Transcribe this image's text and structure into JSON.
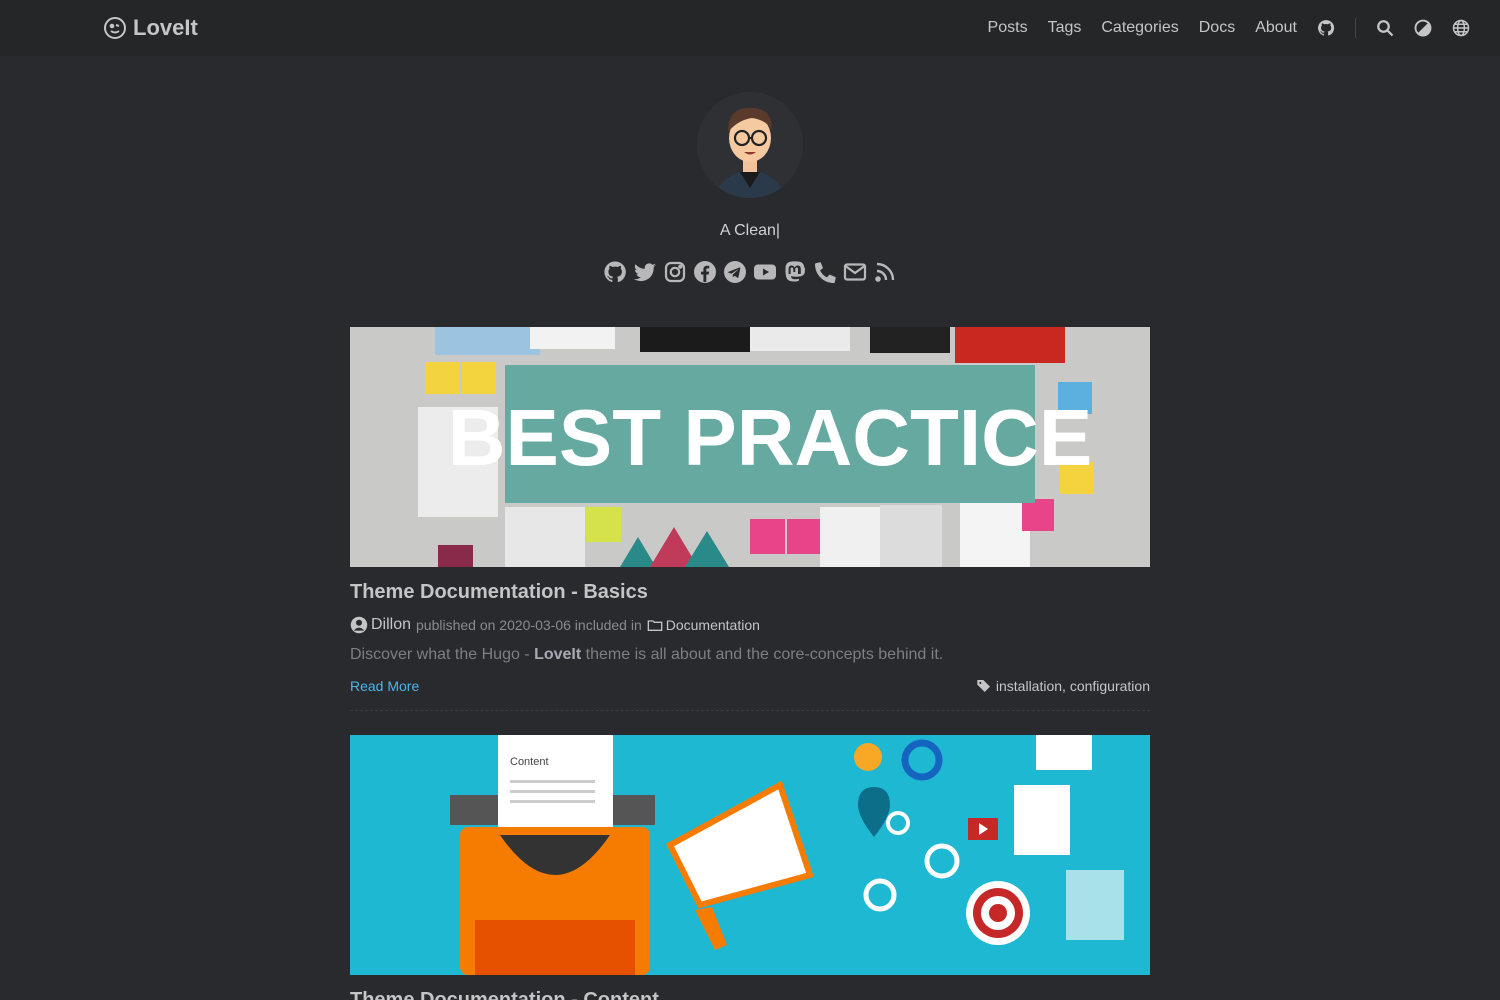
{
  "header": {
    "logo_text": "LoveIt",
    "nav": [
      "Posts",
      "Tags",
      "Categories",
      "Docs",
      "About"
    ],
    "icons": [
      "github-icon",
      "search-icon",
      "theme-switch-icon",
      "language-icon"
    ]
  },
  "profile": {
    "subtitle": "A Clean|",
    "social_icons": [
      "github-icon",
      "twitter-icon",
      "instagram-icon",
      "facebook-icon",
      "telegram-icon",
      "youtube-icon",
      "mastodon-icon",
      "phone-icon",
      "email-icon",
      "rss-icon"
    ]
  },
  "posts": [
    {
      "image_text": "BEST PRACTICE",
      "title": "Theme Documentation - Basics",
      "author": "Dillon",
      "published": "published on 2020-03-06 included in",
      "category": "Documentation",
      "summary_before": "Discover what the Hugo - ",
      "summary_bold": "LoveIt",
      "summary_after": " theme is all about and the core-concepts behind it.",
      "read_more": "Read More",
      "tags": "installation, configuration"
    },
    {
      "image_text": "Content",
      "title": "Theme Documentation - Content"
    }
  ],
  "colors": {
    "background": "#292a2d",
    "header": "#252627",
    "link": "#4cb5e8"
  }
}
